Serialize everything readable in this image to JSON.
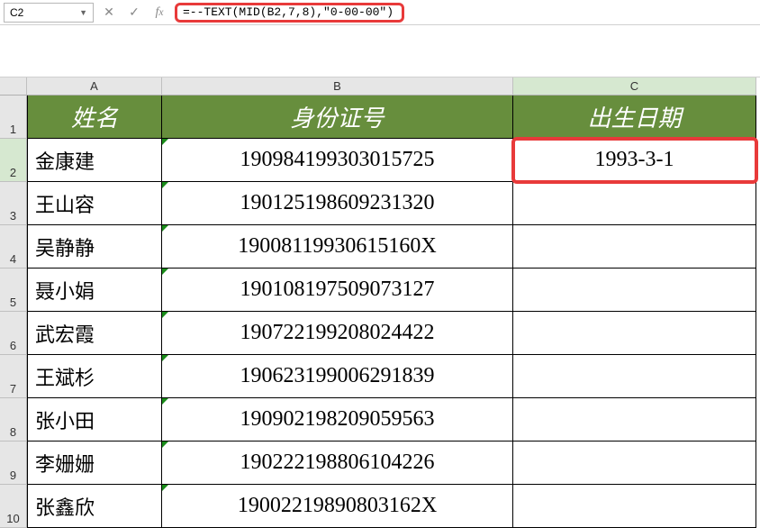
{
  "name_box": "C2",
  "formula": "=--TEXT(MID(B2,7,8),\"0-00-00\")",
  "col_headers": [
    "A",
    "B",
    "C"
  ],
  "active_col": "C",
  "active_row": 2,
  "header_row": {
    "a": "姓名",
    "b": "身份证号",
    "c": "出生日期"
  },
  "rows": [
    {
      "a": "金康建",
      "b": "190984199303015725",
      "c": "1993-3-1"
    },
    {
      "a": "王山容",
      "b": "190125198609231320",
      "c": ""
    },
    {
      "a": "吴静静",
      "b": "19008119930615160X",
      "c": ""
    },
    {
      "a": "聂小娟",
      "b": "190108197509073127",
      "c": ""
    },
    {
      "a": "武宏霞",
      "b": "190722199208024422",
      "c": ""
    },
    {
      "a": "王斌杉",
      "b": "190623199006291839",
      "c": ""
    },
    {
      "a": "张小田",
      "b": "190902198209059563",
      "c": ""
    },
    {
      "a": "李姗姗",
      "b": "190222198806104226",
      "c": ""
    },
    {
      "a": "张鑫欣",
      "b": "19002219890803162X",
      "c": ""
    }
  ],
  "chart_data": {
    "type": "table",
    "title": "",
    "columns": [
      "姓名",
      "身份证号",
      "出生日期"
    ],
    "rows": [
      [
        "金康建",
        "190984199303015725",
        "1993-3-1"
      ],
      [
        "王山容",
        "190125198609231320",
        ""
      ],
      [
        "吴静静",
        "19008119930615160X",
        ""
      ],
      [
        "聂小娟",
        "190108197509073127",
        ""
      ],
      [
        "武宏霞",
        "190722199208024422",
        ""
      ],
      [
        "王斌杉",
        "190623199006291839",
        ""
      ],
      [
        "张小田",
        "190902198209059563",
        ""
      ],
      [
        "李姗姗",
        "190222198806104226",
        ""
      ],
      [
        "张鑫欣",
        "19002219890803162X",
        ""
      ]
    ]
  }
}
